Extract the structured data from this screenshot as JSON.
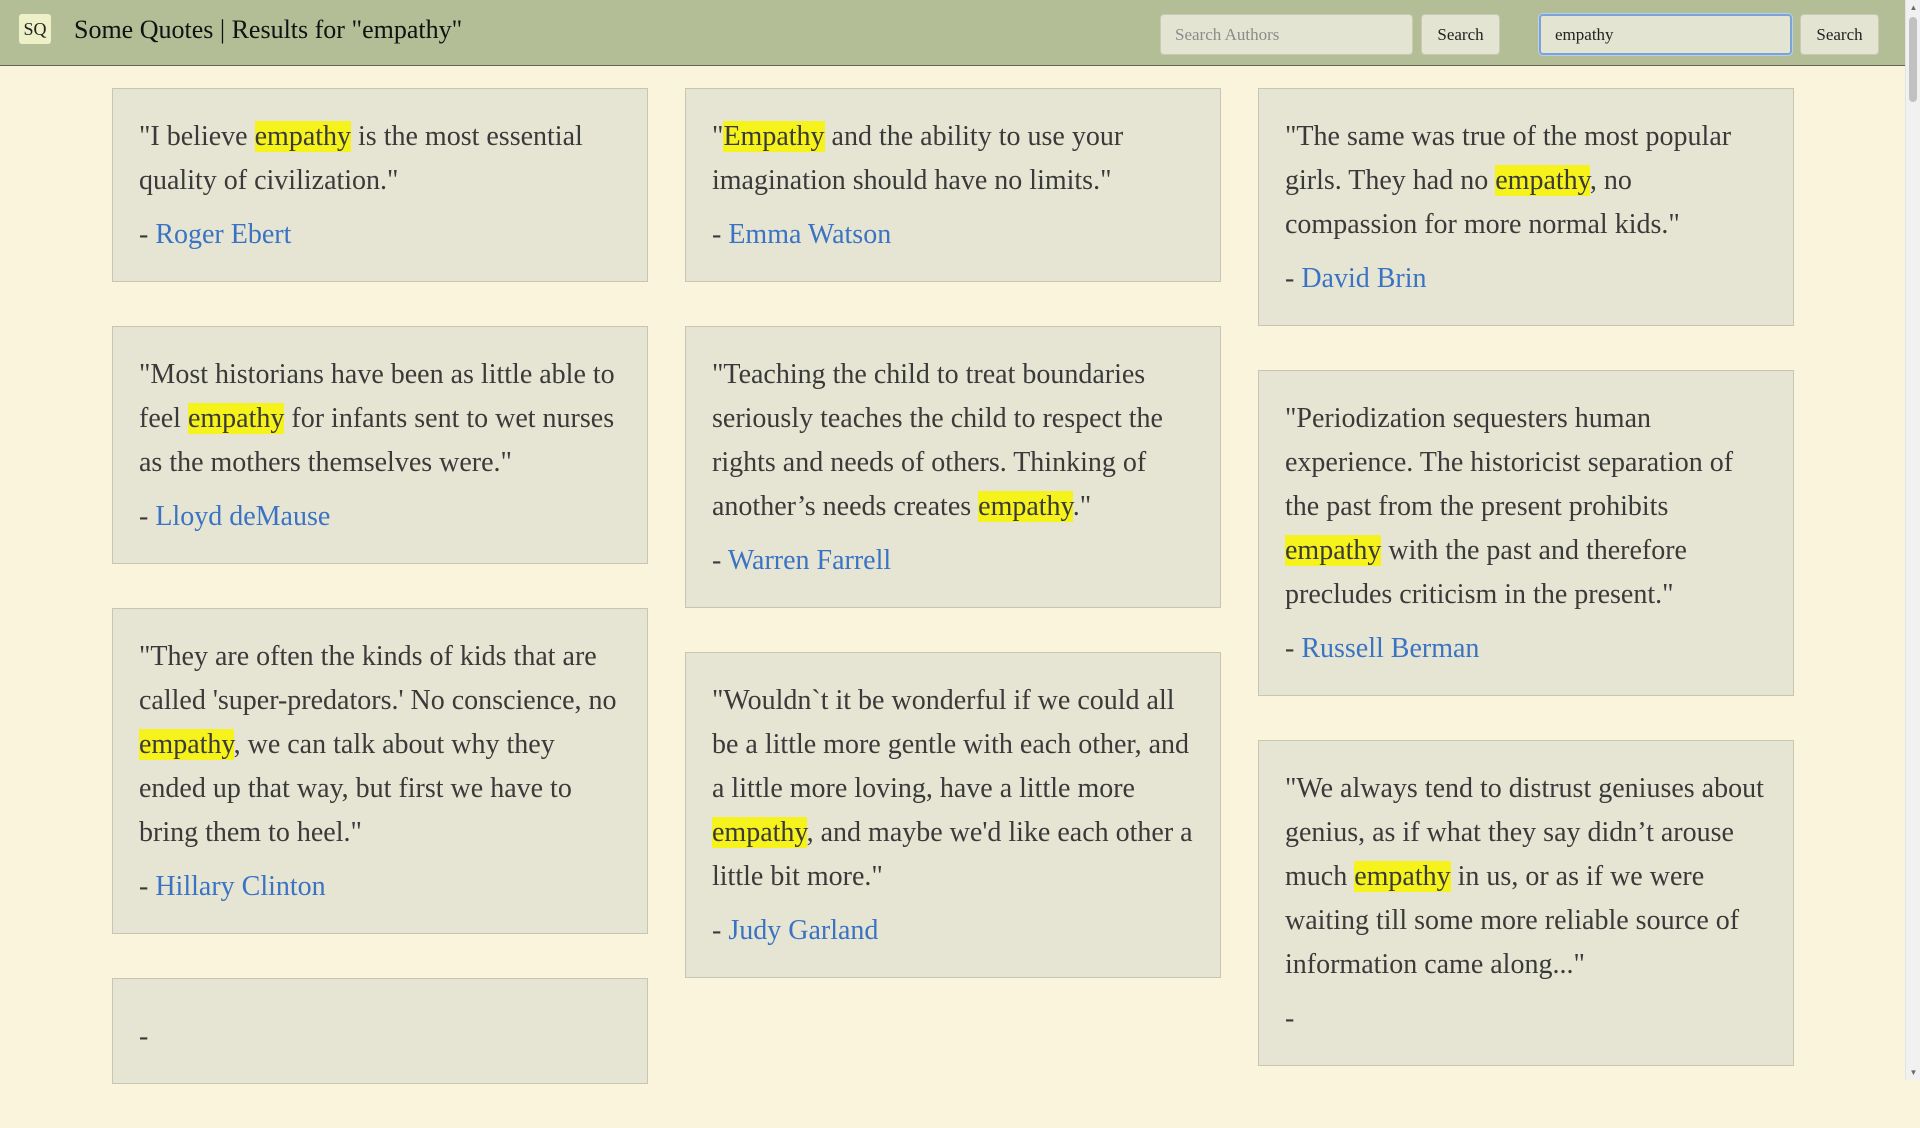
{
  "header": {
    "logo": "SQ",
    "title": "Some Quotes | Results for \"empathy\"",
    "author_search": {
      "placeholder": "Search Authors",
      "value": ""
    },
    "author_search_button": "Search",
    "quote_search": {
      "placeholder": "",
      "value": "empathy"
    },
    "quote_search_button": "Search"
  },
  "columns": [
    [
      {
        "parts": [
          {
            "t": "\"I believe "
          },
          {
            "t": "empathy",
            "hl": true
          },
          {
            "t": " is the most essential quality of civilization.\""
          }
        ],
        "author": "Roger Ebert"
      },
      {
        "parts": [
          {
            "t": "\"Most historians have been as little able to feel "
          },
          {
            "t": "empathy",
            "hl": true
          },
          {
            "t": " for infants sent to wet nurses as the mothers themselves were.\""
          }
        ],
        "author": "Lloyd deMause"
      },
      {
        "parts": [
          {
            "t": "\"They are often the kinds of kids that are called 'super-predators.' No conscience, no "
          },
          {
            "t": "empathy",
            "hl": true
          },
          {
            "t": ", we can talk about why they ended up that way, but first we have to bring them to heel.\""
          }
        ],
        "author": "Hillary Clinton"
      },
      {
        "parts": [
          {
            "t": ""
          }
        ],
        "author": ""
      }
    ],
    [
      {
        "parts": [
          {
            "t": "\""
          },
          {
            "t": "Empathy",
            "hl": true
          },
          {
            "t": " and the ability to use your imagination should have no limits.\""
          }
        ],
        "author": "Emma Watson"
      },
      {
        "parts": [
          {
            "t": "\"Teaching the child to treat boundaries seriously teaches the child to respect the rights and needs of others. Thinking of another’s needs creates "
          },
          {
            "t": "empathy",
            "hl": true
          },
          {
            "t": ".\""
          }
        ],
        "author": "Warren Farrell"
      },
      {
        "parts": [
          {
            "t": "\"Wouldn`t it be wonderful if we could all be a little more gentle with each other, and a little more loving, have a little more "
          },
          {
            "t": "empathy",
            "hl": true
          },
          {
            "t": ", and maybe we'd like each other a little bit more.\""
          }
        ],
        "author": "Judy Garland"
      }
    ],
    [
      {
        "parts": [
          {
            "t": "\"The same was true of the most popular girls. They had no "
          },
          {
            "t": "empathy",
            "hl": true
          },
          {
            "t": ", no compassion for more normal kids.\""
          }
        ],
        "author": "David Brin"
      },
      {
        "parts": [
          {
            "t": "\"Periodization sequesters human experience. The historicist separation of the past from the present prohibits "
          },
          {
            "t": "empathy",
            "hl": true
          },
          {
            "t": " with the past and therefore precludes criticism in the present.\""
          }
        ],
        "author": "Russell Berman"
      },
      {
        "parts": [
          {
            "t": "\"We always tend to distrust geniuses about genius, as if what they say didn’t arouse much "
          },
          {
            "t": "empathy",
            "hl": true
          },
          {
            "t": " in us, or as if we were waiting till some more reliable source of information came along...\""
          }
        ],
        "author": ""
      }
    ]
  ],
  "colors": {
    "header_bg": "#b3be96",
    "page_bg": "#fbf4dc",
    "card_bg": "#e6e5d3",
    "highlight": "#f6f21c",
    "link": "#3b73c4"
  }
}
